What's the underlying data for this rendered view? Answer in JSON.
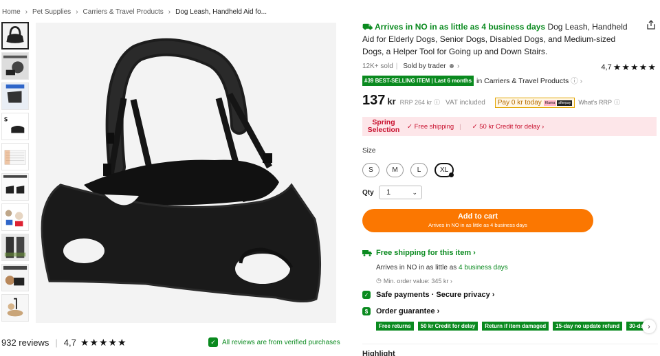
{
  "breadcrumb": {
    "items": [
      "Home",
      "Pet Supplies",
      "Carriers & Travel Products",
      "Dog Leash, Handheld Aid fo..."
    ],
    "separator": "›"
  },
  "gallery": {
    "thumbnail_count": 10,
    "selected_index": 0
  },
  "reviews": {
    "count_text": "932 reviews",
    "rating": "4,7",
    "stars": "★★★★★",
    "verified_text": "All reviews are from verified purchases"
  },
  "product": {
    "arrival_highlight": "Arrives in NO in as little as 4 business days",
    "title": "Dog Leash, Handheld Aid for Elderly Dogs, Senior Dogs, Disabled Dogs, and Medium-sized Dogs, a Helper Tool for Going up and Down Stairs.",
    "sold": "12K+ sold",
    "sold_by": "Sold by trader",
    "rating": "4,7",
    "stars": "★★★★★",
    "best_badge": "#39 BEST-SELLING ITEM | Last 6 months",
    "best_category": "in Carriers & Travel Products",
    "price": "137",
    "price_unit": "kr",
    "rrp": "RRP 264 kr",
    "vat": "VAT included",
    "pay_today": "Pay 0 kr today",
    "klarna": "Klarna",
    "klarna2": "afterpay",
    "whats_rrp": "What's RRP"
  },
  "promo": {
    "title": "Spring Selection",
    "free_shipping": "Free shipping",
    "credit": "50 kr Credit for delay ›"
  },
  "size": {
    "label": "Size",
    "options": [
      "S",
      "M",
      "L",
      "XL"
    ],
    "selected": "XL"
  },
  "qty": {
    "label": "Qty",
    "value": "1"
  },
  "cart": {
    "label": "Add to cart",
    "sublabel": "Arrives in NO in as little as 4 business days"
  },
  "shipping": {
    "heading": "Free shipping for this item ›",
    "arrive_prefix": "Arrives in NO in as little as",
    "arrive_days": "4 business days",
    "min_order": "Min. order value: 345 kr ›"
  },
  "safe": {
    "label": "Safe payments · Secure privacy ›"
  },
  "guarantee": {
    "label": "Order guarantee ›",
    "tags": [
      "Free returns",
      "50 kr Credit for delay",
      "Return if item damaged",
      "15-day no update refund",
      "30-da"
    ]
  },
  "highlight": {
    "label": "Highlight"
  },
  "colors": {
    "accent_orange": "#fb7701",
    "green": "#0a8a1f",
    "promo_bg": "#fde6e9",
    "promo_red": "#c8102e"
  }
}
